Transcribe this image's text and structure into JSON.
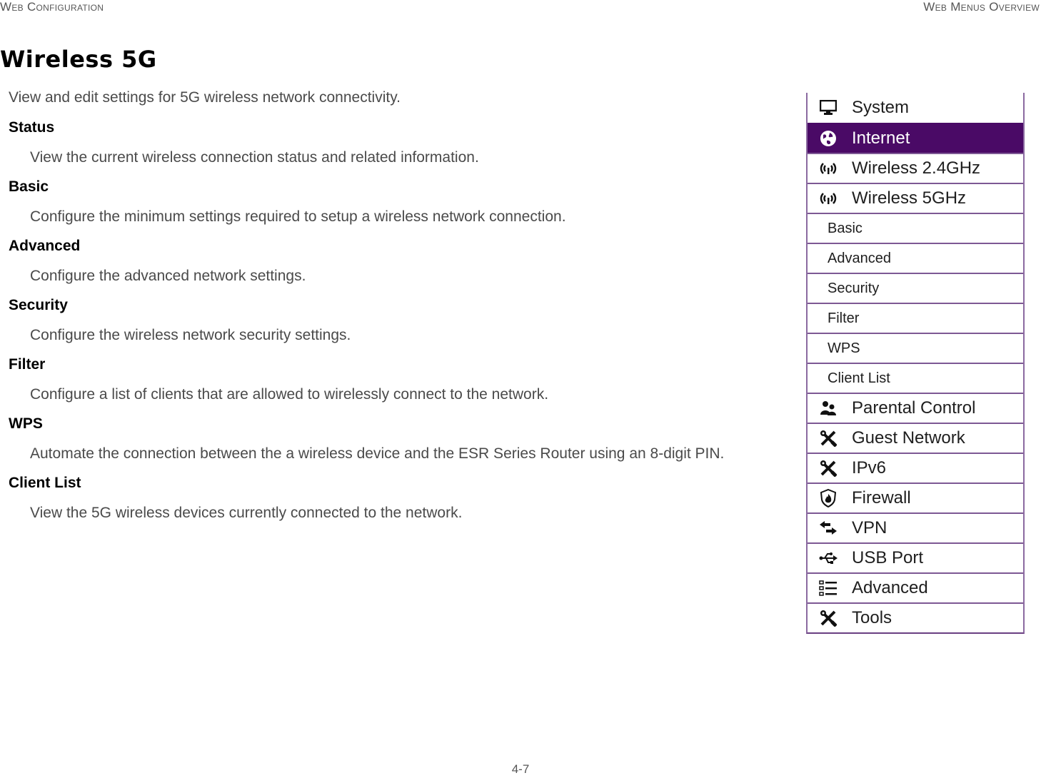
{
  "header": {
    "left": "Web Configuration",
    "right": "Web Menus Overview"
  },
  "page_title": "Wireless 5G",
  "intro": "View and edit settings for 5G wireless network connectivity.",
  "sections": [
    {
      "term": "Status",
      "description": "View the current wireless connection status and related information."
    },
    {
      "term": "Basic",
      "description": "Configure the minimum settings required to setup a wireless network connection."
    },
    {
      "term": "Advanced",
      "description": "Configure the advanced network settings."
    },
    {
      "term": "Security",
      "description": "Configure the wireless network security settings."
    },
    {
      "term": "Filter",
      "description": "Configure a list of clients that are allowed to wirelessly connect to the network."
    },
    {
      "term": "WPS",
      "description": "Automate the connection between the a wireless device and the ESR Series Router using an 8-digit PIN."
    },
    {
      "term": "Client List",
      "description": "View the 5G wireless devices currently connected to the network."
    }
  ],
  "menu": {
    "accent_color": "#4a0a66",
    "items": [
      {
        "label": "System",
        "icon": "monitor-icon"
      },
      {
        "label": "Internet",
        "icon": "globe-icon",
        "active": true
      },
      {
        "label": "Wireless 2.4GHz",
        "icon": "wireless-antenna-icon"
      },
      {
        "label": "Wireless 5GHz",
        "icon": "wireless-antenna-icon"
      },
      {
        "label": "Basic",
        "sub": true
      },
      {
        "label": "Advanced",
        "sub": true
      },
      {
        "label": "Security",
        "sub": true
      },
      {
        "label": "Filter",
        "sub": true
      },
      {
        "label": "WPS",
        "sub": true
      },
      {
        "label": "Client List",
        "sub": true
      },
      {
        "label": "Parental Control",
        "icon": "users-icon"
      },
      {
        "label": "Guest Network",
        "icon": "tools-icon"
      },
      {
        "label": "IPv6",
        "icon": "tools-icon"
      },
      {
        "label": "Firewall",
        "icon": "shield-fire-icon"
      },
      {
        "label": "VPN",
        "icon": "exchange-arrows-icon"
      },
      {
        "label": "USB Port",
        "icon": "usb-icon"
      },
      {
        "label": "Advanced",
        "icon": "list-icon"
      },
      {
        "label": "Tools",
        "icon": "tools-icon"
      }
    ]
  },
  "footer": {
    "page_number": "4-7"
  }
}
